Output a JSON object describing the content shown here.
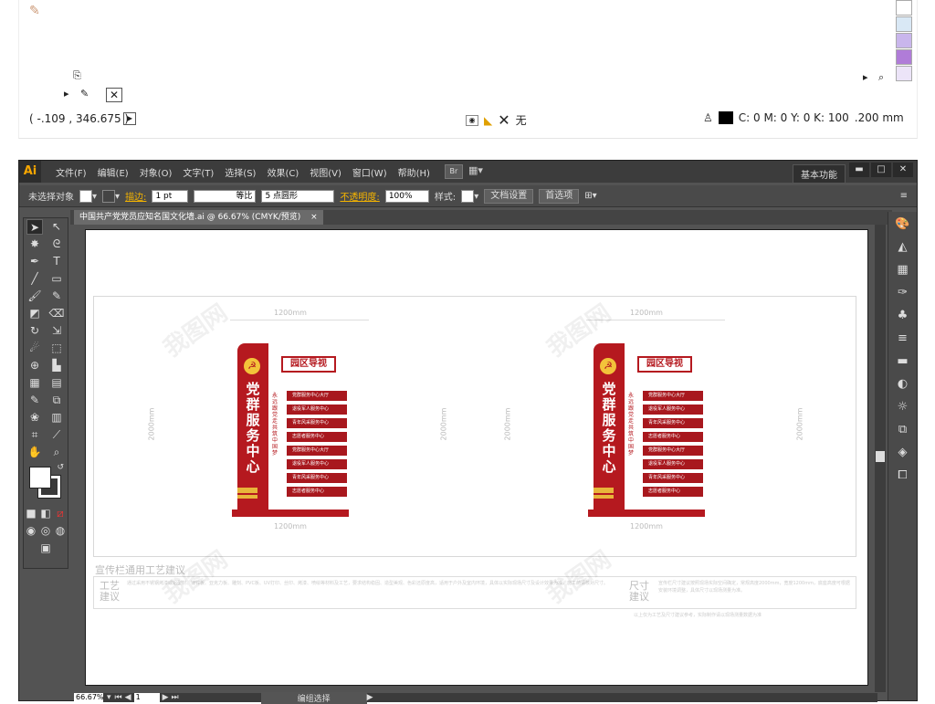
{
  "top_status": {
    "coordinates": "( -.109 , 346.675 )",
    "fill_label": "无",
    "cmyk_value": "C: 0 M: 0 Y: 0 K: 100",
    "stroke_value": ".200 mm",
    "swatch_colors": [
      "#ffffff",
      "#d9e8f5",
      "#c9b6ec",
      "#b07cd8",
      "#ece4f8"
    ]
  },
  "menubar": {
    "logo": "Ai",
    "items": [
      "文件(F)",
      "编辑(E)",
      "对象(O)",
      "文字(T)",
      "选择(S)",
      "效果(C)",
      "视图(V)",
      "窗口(W)",
      "帮助(H)"
    ],
    "bridge": "Br",
    "workspace": "基本功能",
    "win_buttons": [
      "▬",
      "□",
      "✕"
    ]
  },
  "control_bar": {
    "selection": "未选择对象",
    "stroke_label": "描边:",
    "stroke_width": "1 pt",
    "stroke_profile": "等比",
    "brush": "5 点圆形",
    "opacity_label": "不透明度:",
    "opacity_value": "100%",
    "style_label": "样式:",
    "doc_setup": "文档设置",
    "preferences": "首选项"
  },
  "tab": {
    "title": "中国共产党党员应知名国文化墙.ai @ 66.67% (CMYK/预览)",
    "close": "×"
  },
  "statusbar": {
    "zoom": "66.67%",
    "page": "1",
    "mode": "编组选择"
  },
  "design": {
    "width_dim": "1200mm",
    "height_dim": "2000mm",
    "pole_text": "党群服务中心",
    "pole_sub": "永远跟党走 共筑中国梦",
    "sign_title": "园区导视",
    "sign_rows": [
      "党群服务中心大厅",
      "退役军人服务中心",
      "青年风采服务中心",
      "志愿者服务中心",
      "党群服务中心大厅",
      "退役军人服务中心",
      "青年风采服务中心",
      "志愿者服务中心"
    ],
    "caption": "宣传栏通用工艺建议",
    "spec_left_label": "工艺建议",
    "spec_right_label": "尺寸建议",
    "spec_left_text": "通过采用不锈钢烤漆或铝型材、镀锌板、亚克力板、雕刻、PVC板、UV打印、丝印、烤漆、喷绘等材料及工艺，要求结构稳固、造型美观、色彩还原度高，适用于户外及室内环境，具体以实际现场尺寸及设计效果为准，施工前请核对尺寸。",
    "spec_right_text": "宣传栏尺寸建议按照现场实际空间确定，常规高度2000mm，宽度1200mm，底座高度可根据安装环境调整，具体尺寸以现场测量为准。",
    "spec_bottom_text": "以上仅为工艺及尺寸建议参考，实际制作请以现场测量数据为准"
  }
}
